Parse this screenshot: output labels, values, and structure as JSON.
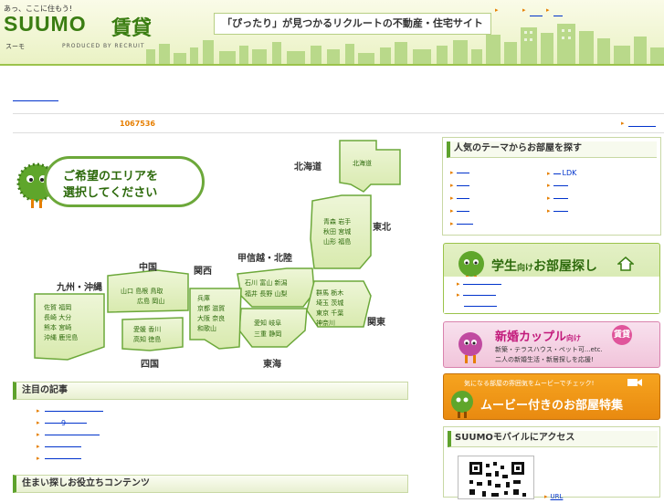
{
  "header": {
    "tagline_small": "あっ、ここに住もう!",
    "logo": "SUUMO",
    "logo_kanji": "賃貸",
    "logo_kana": "スーモ",
    "produced_by": "PRODUCED BY RECRUIT",
    "catchphrase": "「ぴったり」が見つかるリクルートの不動産・住宅サイト"
  },
  "property_count": "1067536",
  "map": {
    "bubble_line1": "ご希望のエリアを",
    "bubble_line2": "選択してください",
    "regions": {
      "hokkaido": "北海道",
      "tohoku": "東北",
      "koshinetsu_hokuriku": "甲信越・北陸",
      "kanto": "関東",
      "tokai": "東海",
      "kansai": "関西",
      "chugoku": "中国",
      "shikoku": "四国",
      "kyushu_okinawa": "九州・沖縄"
    },
    "prefs": {
      "hokkaido_box": "北海道",
      "tohoku_r1": "青森 岩手",
      "tohoku_r2": "秋田 宮城",
      "tohoku_r3": "山形 福島",
      "hokuriku_r1": "石川 富山 新潟",
      "hokuriku_r2": "福井 長野 山梨",
      "kanto_r1": "群馬 栃木",
      "kanto_r2": "埼玉 茨城",
      "kanto_r3": "東京 千葉",
      "kanto_r4": "神奈川",
      "tokai_r1": "愛知 岐阜",
      "tokai_r2": "三重 静岡",
      "kansai_r1": "兵庫",
      "kansai_r2": "京都 滋賀",
      "kansai_r3": "大阪 奈良",
      "kansai_r4": "和歌山",
      "chugoku_r1": "山口 島根 鳥取",
      "chugoku_r2": "広島 岡山",
      "shikoku_r1": "愛媛 香川",
      "shikoku_r2": "高知 徳島",
      "kyushu_r1": "佐賀 福岡",
      "kyushu_r2": "長崎 大分",
      "kyushu_r3": "熊本 宮崎",
      "kyushu_r4": "沖縄 鹿児島"
    }
  },
  "sections": {
    "featured": "注目の記事",
    "useful": "住まい探しお役立ちコンテンツ"
  },
  "featured_item2_suffix": "9",
  "sidebar": {
    "theme_title": "人気のテーマからお部屋を探す",
    "theme_ldk": "LDK",
    "student_title": "学生向けお部屋探し",
    "student_pre": "学生",
    "student_mid": "向け",
    "student_post": "お部屋探し",
    "newlywed_title": "新婚カップル",
    "newlywed_suffix": "向け",
    "newlywed_badge": "賃貸",
    "newlywed_line1": "新築・テラスハウス・ペット可...etc.",
    "newlywed_line2": "二人の新婚生活・新居探しを応援!",
    "movie_top": "気になる部屋の雰囲気をムービーでチェック!",
    "movie_title": "ムービー付きのお部屋特集",
    "mobile_title": "SUUMOモバイルにアクセス",
    "mobile_url": "URL"
  },
  "colors": {
    "brand_green": "#3a7d12",
    "accent_orange": "#e67e00",
    "link_blue": "#0033cc"
  }
}
